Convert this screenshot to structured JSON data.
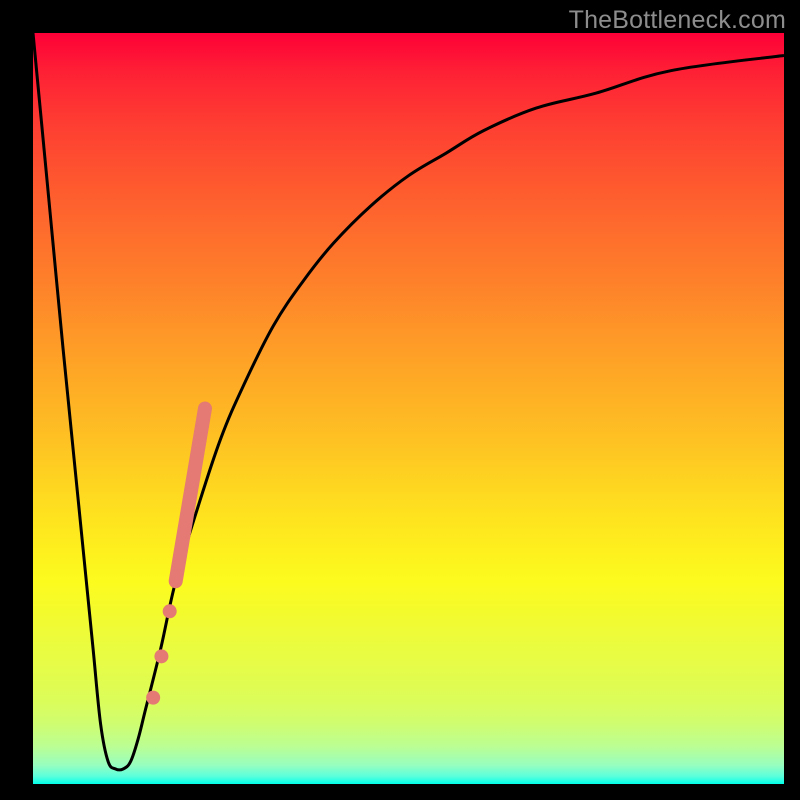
{
  "watermark": "TheBottleneck.com",
  "colors": {
    "curve": "#000000",
    "marker_fill": "#e47a73",
    "marker_stroke": "#e47a73",
    "background_border": "#000000"
  },
  "chart_data": {
    "type": "line",
    "title": "",
    "xlabel": "",
    "ylabel": "",
    "xlim": [
      0,
      100
    ],
    "ylim": [
      0,
      100
    ],
    "grid": false,
    "annotations": [
      "TheBottleneck.com"
    ],
    "series": [
      {
        "name": "bottleneck-curve",
        "x": [
          0,
          2,
          4,
          6,
          7,
          8,
          9,
          10,
          11,
          12,
          13,
          14,
          15,
          17,
          19,
          22,
          25,
          28,
          32,
          36,
          40,
          45,
          50,
          55,
          60,
          67,
          75,
          85,
          100
        ],
        "y": [
          100,
          79,
          58,
          38,
          28,
          18,
          8,
          3,
          2,
          2,
          3,
          6,
          10,
          18,
          27,
          37,
          46,
          53,
          61,
          67,
          72,
          77,
          81,
          84,
          87,
          90,
          92,
          95,
          97
        ]
      }
    ],
    "markers": [
      {
        "name": "segment-large",
        "type": "line-segment",
        "x": [
          19.0,
          22.9
        ],
        "y": [
          27.0,
          50.0
        ],
        "width": 14
      },
      {
        "name": "dot-1",
        "type": "dot",
        "x": 18.2,
        "y": 23.0,
        "r": 7
      },
      {
        "name": "dot-2",
        "type": "dot",
        "x": 17.1,
        "y": 17.0,
        "r": 7
      },
      {
        "name": "dot-3",
        "type": "dot",
        "x": 16.0,
        "y": 11.5,
        "r": 7
      }
    ]
  }
}
